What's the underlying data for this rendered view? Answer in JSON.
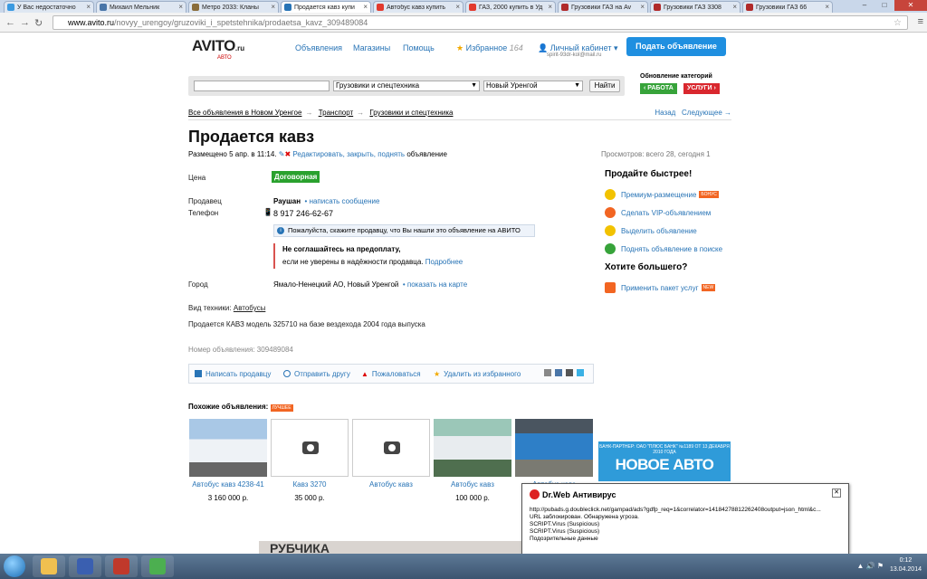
{
  "browser": {
    "tabs": [
      {
        "label": "У Вас недостаточно ",
        "color": "#3b9ae1",
        "active": false
      },
      {
        "label": "Михаил Мельник",
        "color": "#4a76a8",
        "active": false
      },
      {
        "label": "Метро 2033: Кланы",
        "color": "#8a6d3b",
        "active": false
      },
      {
        "label": "Продается кавз купи",
        "color": "#2874b6",
        "active": true
      },
      {
        "label": "Автобус кавз купить",
        "color": "#e23a2e",
        "active": false
      },
      {
        "label": "ГАЗ, 2000 купить в Уд",
        "color": "#e23a2e",
        "active": false
      },
      {
        "label": "Грузовики ГАЗ на Av",
        "color": "#b02a2a",
        "active": false
      },
      {
        "label": "Грузовики ГАЗ 3308",
        "color": "#b02a2a",
        "active": false
      },
      {
        "label": "Грузовики ГАЗ 66",
        "color": "#b02a2a",
        "active": false
      }
    ],
    "url_host": "www.avito.ru",
    "url_path": "/novyy_urengoy/gruzoviki_i_spetstehnika/prodaetsa_kavz_309489084",
    "colors": {
      "accent": "#2874b6"
    }
  },
  "header": {
    "logo_text": "AVITO",
    "logo_ru": ".ru",
    "logo_sub": "АВТО",
    "nav": [
      "Объявления",
      "Магазины",
      "Помощь"
    ],
    "favorites_label": "Избранное",
    "favorites_count": "164",
    "cabinet_label": "Личный кабинет",
    "cabinet_email": "spirit-93dr-kol@mail.ru",
    "post_button": "Подать объявление"
  },
  "search": {
    "query": "",
    "category": "Грузовики и спецтехника",
    "city": "Новый Уренгой",
    "button": "Найти",
    "cat_update_title": "Обновление категорий",
    "btn_work": "РАБОТА",
    "btn_services": "УСЛУГИ"
  },
  "breadcrumbs": {
    "items": [
      "Все объявления в Новом Уренгое",
      "Транспорт",
      "Грузовики и спецтехника"
    ],
    "back": "Назад",
    "next": "Следующее →"
  },
  "listing": {
    "title": "Продается кавз",
    "posted": "Размещено 5 апр. в 11:14.",
    "edit_link": "Редактировать, закрыть, поднять",
    "edit_suffix": "объявление",
    "views": "Просмотров: всего 28, сегодня 1",
    "price_label": "Цена",
    "price_value": "Договорная",
    "seller_label": "Продавец",
    "seller_name": "Раушан",
    "write_message": "написать сообщение",
    "phone_label": "Телефон",
    "phone": "8 917 246-62-67",
    "hint": "Пожалуйста, скажите продавцу, что Вы нашли это объявление на АВИТО",
    "warn_title": "Не соглашайтесь на предоплату,",
    "warn_text": "если не уверены в надёжности продавца.",
    "warn_link": "Подробнее",
    "city_label": "Город",
    "city_value": "Ямало-Ненецкий АО, Новый Уренгой",
    "map_link": "показать на карте",
    "type_label": "Вид техники:",
    "type_value": "Автобусы",
    "description": "Продается КАВЗ модель 325710 на базе вездехода 2004 года выпуска",
    "number": "Номер объявления: 309489084"
  },
  "actions": {
    "write": "Написать продавцу",
    "send": "Отправить другу",
    "report": "Пожаловаться",
    "unfav": "Удалить из избранного"
  },
  "sidebar": {
    "sell_title": "Продайте быстрее!",
    "items": [
      {
        "label": "Премиум-размещение",
        "color": "#f2c200",
        "badge": "БОНУС"
      },
      {
        "label": "Сделать VIP-объявлением",
        "color": "#f26522",
        "badge": ""
      },
      {
        "label": "Выделить объявление",
        "color": "#f2c200",
        "badge": ""
      },
      {
        "label": "Поднять объявление в поиске",
        "color": "#37a33a",
        "badge": ""
      }
    ],
    "more_title": "Хотите большего?",
    "pack": "Применить пакет услуг",
    "pack_badge": "NEW"
  },
  "similar": {
    "title": "Похожие объявления:",
    "badge": "ЛУЧШЕЕ",
    "items": [
      {
        "name": "Автобус кавз 4238-41",
        "price": "3 160 000 р.",
        "photo": "bus-white"
      },
      {
        "name": "Кавз 3270",
        "price": "35 000 р.",
        "photo": "none"
      },
      {
        "name": "Автобус кавз",
        "price": "",
        "photo": "none"
      },
      {
        "name": "Автобус кавз",
        "price": "100 000 р.",
        "photo": "bus-green"
      },
      {
        "name": "Автобус кавз",
        "price": "",
        "photo": "bus-blue"
      }
    ]
  },
  "banner": {
    "small": "БАНК-ПАРТНЕР: ОАО \"ПЛЮС БАНК\" №1189 ОТ 13 ДЕКАБРЯ 2010 ГОДА",
    "big": "НОВОЕ АВТО"
  },
  "ad_bottom": "РУБЧИКА",
  "drweb": {
    "title": "Dr.Web Антивирус",
    "lines": [
      "http://pubads.g.doubleclick.net/gampad/ads?gdfp_req=1&correlator=14184278812262408output=json_html&c...",
      "URL заблокирован. Обнаружена угроза.",
      "SCRIPT.Virus (Suspicious)",
      "SCRIPT.Virus (Suspicious)",
      "Подозрительные данные"
    ]
  },
  "taskbar": {
    "time": "0:12",
    "date": "13.04.2014",
    "apps": [
      {
        "name": "folder",
        "color": "#f0c050"
      },
      {
        "name": "save",
        "color": "#3a5fb0"
      },
      {
        "name": "antivirus",
        "color": "#c0392b"
      },
      {
        "name": "chrome",
        "color": "#4caf50"
      }
    ]
  }
}
